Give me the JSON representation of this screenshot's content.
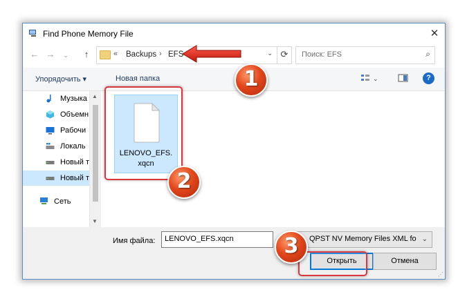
{
  "window": {
    "title": "Find Phone Memory File",
    "close_glyph": "✕"
  },
  "nav": {
    "back_glyph": "←",
    "forward_glyph": "→",
    "up_glyph": "↑",
    "breadcrumb": [
      "Backups",
      "EFS"
    ],
    "overflow_glyph": "«",
    "separator_glyph": "›",
    "dropdown_glyph": "⌄",
    "refresh_glyph": "⟳",
    "search_placeholder": "Поиск: EFS",
    "search_glyph": "⌕"
  },
  "toolbar": {
    "organize_label": "Упорядочить ▾",
    "new_folder_label": "Новая папка"
  },
  "sidebar": {
    "items": [
      {
        "label": "Музыка",
        "icon": "music-icon"
      },
      {
        "label": "Объемн",
        "icon": "3d-objects-icon"
      },
      {
        "label": "Рабочи",
        "icon": "desktop-icon"
      },
      {
        "label": "Локаль",
        "icon": "local-disk-icon"
      },
      {
        "label": "Новый т",
        "icon": "drive-icon"
      },
      {
        "label": "Новый т",
        "icon": "drive-icon",
        "selected": true
      },
      {
        "label": "Сеть",
        "icon": "network-icon"
      }
    ]
  },
  "files": [
    {
      "label": "LENOVO_EFS.\nxqcn",
      "icon": "document-icon",
      "selected": true
    }
  ],
  "bottom": {
    "filename_label": "Имя файла:",
    "filename_value": "LENOVO_EFS.xqcn",
    "filetype_value": "QPST NV Memory Files XML fo",
    "open_label": "Открыть",
    "cancel_label": "Отмена"
  },
  "annotations": {
    "step1": "1",
    "step2": "2",
    "step3": "3",
    "highlight_color": "#d9363e",
    "badge_color": "#e2471c"
  }
}
